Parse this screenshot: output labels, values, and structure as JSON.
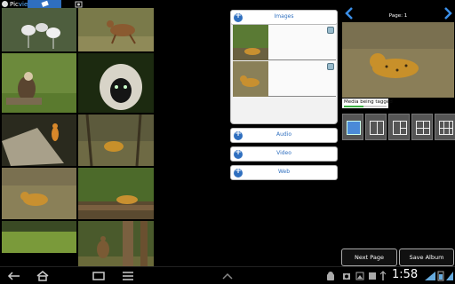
{
  "app": {
    "logo_text_1": "Pic",
    "logo_text_2": "vie"
  },
  "sections": {
    "images": "Images",
    "audio": "Audio",
    "video": "Video",
    "web": "Web"
  },
  "viewer": {
    "page_label": "Page: 1",
    "tag_text": "Media being tagged",
    "tag_progress": 0.45
  },
  "buttons": {
    "next_page": "Next Page",
    "save_album": "Save Album"
  },
  "status": {
    "time": "1:58"
  },
  "colors": {
    "accent": "#2f6fbf",
    "progress": "#3cb043"
  },
  "icons": [
    "back-icon",
    "home-icon",
    "recent-apps-icon",
    "menu-icon",
    "up-chevron-icon",
    "android-icon",
    "camera-icon",
    "image-icon",
    "upload-icon",
    "usb-icon",
    "wifi-icon",
    "battery-icon"
  ]
}
